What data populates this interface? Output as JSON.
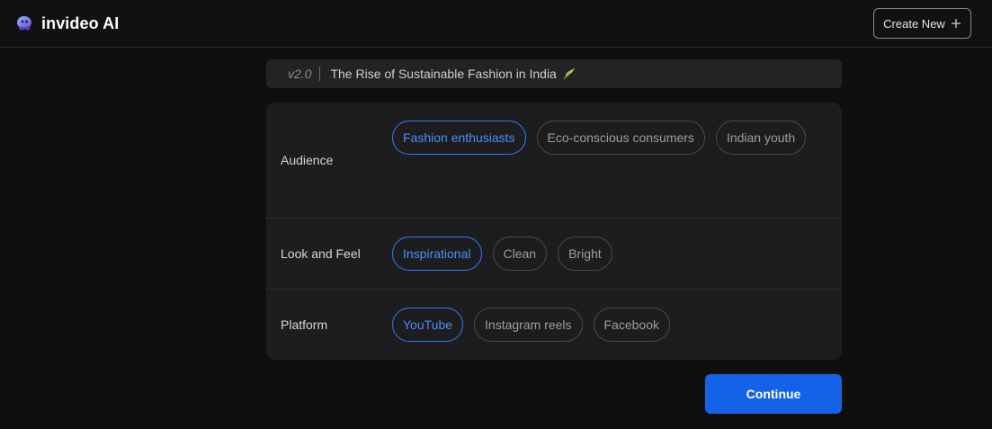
{
  "app": {
    "name": "invideo AI",
    "logo_icon": "invideo-logo-icon"
  },
  "header": {
    "create_new_label": "Create New",
    "create_new_icon": "plus-icon"
  },
  "project": {
    "version": "v2.0",
    "title": "The Rise of Sustainable Fashion in India",
    "title_icon": "leaf-icon"
  },
  "options": [
    {
      "label": "Audience",
      "chips": [
        {
          "label": "Fashion enthusiasts",
          "selected": true
        },
        {
          "label": "Eco-conscious consumers",
          "selected": false
        },
        {
          "label": "Indian youth",
          "selected": false
        }
      ]
    },
    {
      "label": "Look and Feel",
      "chips": [
        {
          "label": "Inspirational",
          "selected": true
        },
        {
          "label": "Clean",
          "selected": false
        },
        {
          "label": "Bright",
          "selected": false
        }
      ]
    },
    {
      "label": "Platform",
      "chips": [
        {
          "label": "YouTube",
          "selected": true
        },
        {
          "label": "Instagram reels",
          "selected": false
        },
        {
          "label": "Facebook",
          "selected": false
        }
      ]
    }
  ],
  "continue_label": "Continue",
  "colors": {
    "accent": "#1463e6",
    "selected_chip": "#2f7cf6",
    "background": "#0f0f10",
    "panel": "#1d1d1f"
  }
}
